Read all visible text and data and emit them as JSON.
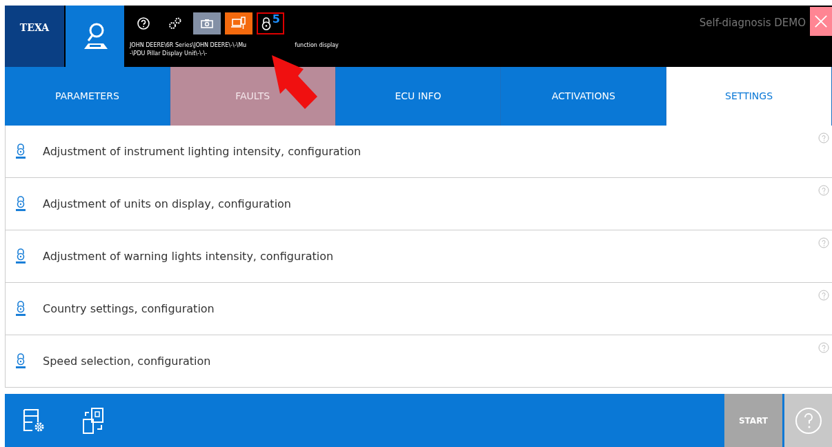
{
  "header": {
    "logo": "TEXA",
    "path_line_1_start": "JOHN DEERE\\6R Series\\JOHN DEERE\\-\\-\\Mu",
    "path_line_1_end": "function display",
    "path_line_2": "-\\PDU Pillar Display Unit\\-\\-\\-",
    "lock_count": "5",
    "title": "Self-diagnosis DEMO"
  },
  "tabs": [
    {
      "label": "PARAMETERS",
      "selected": false,
      "disabled": false
    },
    {
      "label": "FAULTS",
      "selected": false,
      "disabled": true
    },
    {
      "label": "ECU INFO",
      "selected": false,
      "disabled": false
    },
    {
      "label": "ACTIVATIONS",
      "selected": false,
      "disabled": false
    },
    {
      "label": "SETTINGS",
      "selected": true,
      "disabled": false
    }
  ],
  "items": [
    {
      "label": "Adjustment of instrument lighting intensity, configuration"
    },
    {
      "label": "Adjustment of units on display, configuration"
    },
    {
      "label": "Adjustment of warning lights intensity, configuration"
    },
    {
      "label": "Country settings, configuration"
    },
    {
      "label": "Speed selection, configuration"
    }
  ],
  "footer": {
    "start_button": {
      "label": "START",
      "disabled": true
    }
  }
}
